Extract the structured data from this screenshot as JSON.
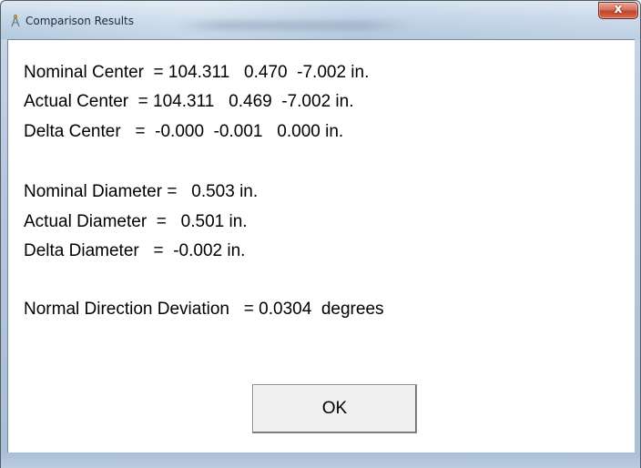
{
  "window": {
    "title": "Comparison Results",
    "close_label": "x"
  },
  "results": {
    "nominal_center": "Nominal Center  = 104.311   0.470  -7.002 in.",
    "actual_center": "Actual Center  = 104.311   0.469  -7.002 in.",
    "delta_center": "Delta Center   =  -0.000  -0.001   0.000 in.",
    "nominal_diameter": "Nominal Diameter =   0.503 in.",
    "actual_diameter": "Actual Diameter  =   0.501 in.",
    "delta_diameter": "Delta Diameter   =  -0.002 in.",
    "normal_direction_deviation": "Normal Direction Deviation   = 0.0304  degrees"
  },
  "buttons": {
    "ok_label": "OK"
  },
  "colors": {
    "frame": "#b4c8de",
    "close_button": "#c2442b",
    "client_background": "#ffffff",
    "button_face": "#f0f0f0"
  },
  "icons": {
    "app": "compass-icon",
    "close": "close-icon"
  }
}
